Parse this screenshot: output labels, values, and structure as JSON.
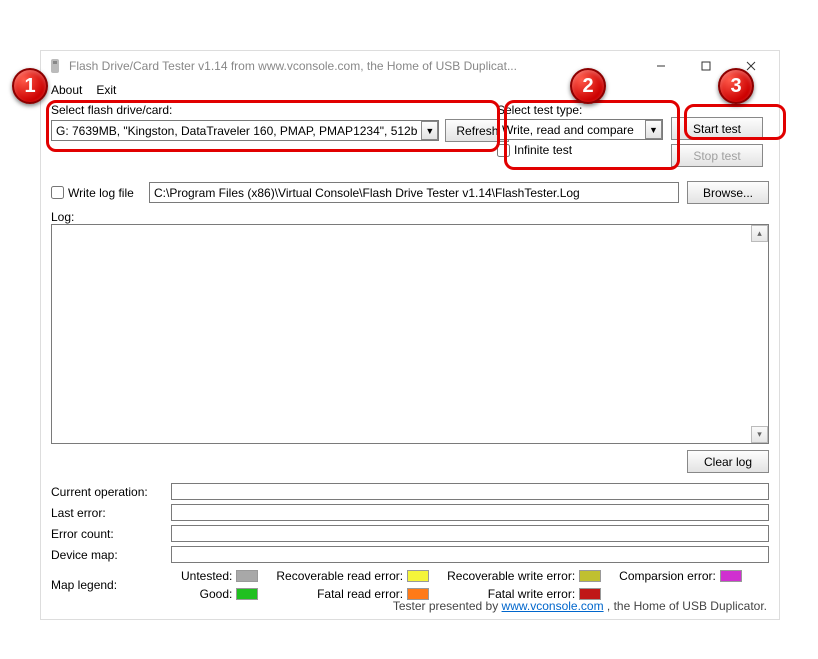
{
  "window": {
    "title": "Flash Drive/Card Tester v1.14 from www.vconsole.com, the Home of USB Duplicat..."
  },
  "menu": {
    "about": "About",
    "exit": "Exit"
  },
  "drive_section": {
    "label": "Select flash drive/card:",
    "selected": "G: 7639MB, \"Kingston, DataTraveler 160, PMAP, PMAP1234\", 512b",
    "refresh": "Refresh"
  },
  "test_section": {
    "label": "Select test type:",
    "selected": "Write, read and compare",
    "infinite": "Infinite test"
  },
  "actions": {
    "start": "Start test",
    "stop": "Stop test"
  },
  "logfile": {
    "check_label": "Write log file",
    "path": "C:\\Program Files (x86)\\Virtual Console\\Flash Drive Tester v1.14\\FlashTester.Log",
    "browse": "Browse..."
  },
  "log": {
    "label": "Log:",
    "clear": "Clear log"
  },
  "status": {
    "current_op_label": "Current operation:",
    "last_error_label": "Last error:",
    "error_count_label": "Error count:",
    "device_map_label": "Device map:"
  },
  "legend": {
    "label": "Map legend:",
    "untested": "Untested:",
    "good": "Good:",
    "rec_read": "Recoverable read error:",
    "fatal_read": "Fatal read error:",
    "rec_write": "Recoverable write error:",
    "fatal_write": "Fatal write error:",
    "comparison": "Comparsion error:",
    "colors": {
      "untested": "#a8a8a8",
      "good": "#20c020",
      "rec_read": "#f5f53a",
      "fatal_read": "#ff7a18",
      "rec_write": "#c0c030",
      "fatal_write": "#c01818",
      "comparison": "#d030d0"
    }
  },
  "footer": {
    "pre": "Tester presented by ",
    "link": "www.vconsole.com",
    "post": " , the Home of USB Duplicator."
  },
  "annotations": {
    "b1": "1",
    "b2": "2",
    "b3": "3"
  }
}
